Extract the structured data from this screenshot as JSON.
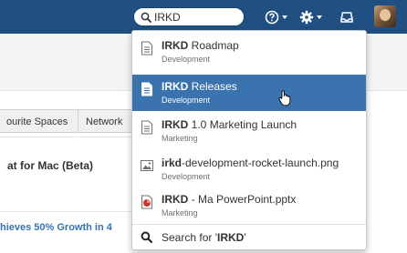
{
  "header": {
    "search_value": "IRKD",
    "help_icon": "help-icon",
    "settings_icon": "gear-icon",
    "notifications_icon": "notification-icon",
    "colors": {
      "header_bg": "#205081",
      "accent": "#3b73af"
    }
  },
  "page": {
    "tabs": [
      "ourite Spaces",
      "Network"
    ],
    "space_title": "at for Mac (Beta)",
    "news_link": "hieves 50% Growth in 4"
  },
  "dropdown": {
    "results": [
      {
        "title_bold": "IRKD",
        "title_rest": " Roadmap",
        "space": "Development",
        "icon": "page-icon"
      },
      {
        "title_bold": "IRKD",
        "title_rest": " Releases",
        "space": "Development",
        "icon": "page-icon",
        "selected": true
      },
      {
        "title_bold": "IRKD",
        "title_rest": " 1.0 Marketing Launch",
        "space": "Marketing",
        "icon": "page-icon"
      },
      {
        "title_bold": "irkd",
        "title_rest": "-development-rocket-launch.png",
        "space": "Development",
        "icon": "image-file-icon"
      },
      {
        "title_bold": "IRKD",
        "title_rest": " - Ma PowerPoint.pptx",
        "space": "Marketing",
        "icon": "powerpoint-file-icon"
      }
    ],
    "footer_prefix": "Search for '",
    "footer_term": "IRKD",
    "footer_suffix": "'"
  }
}
